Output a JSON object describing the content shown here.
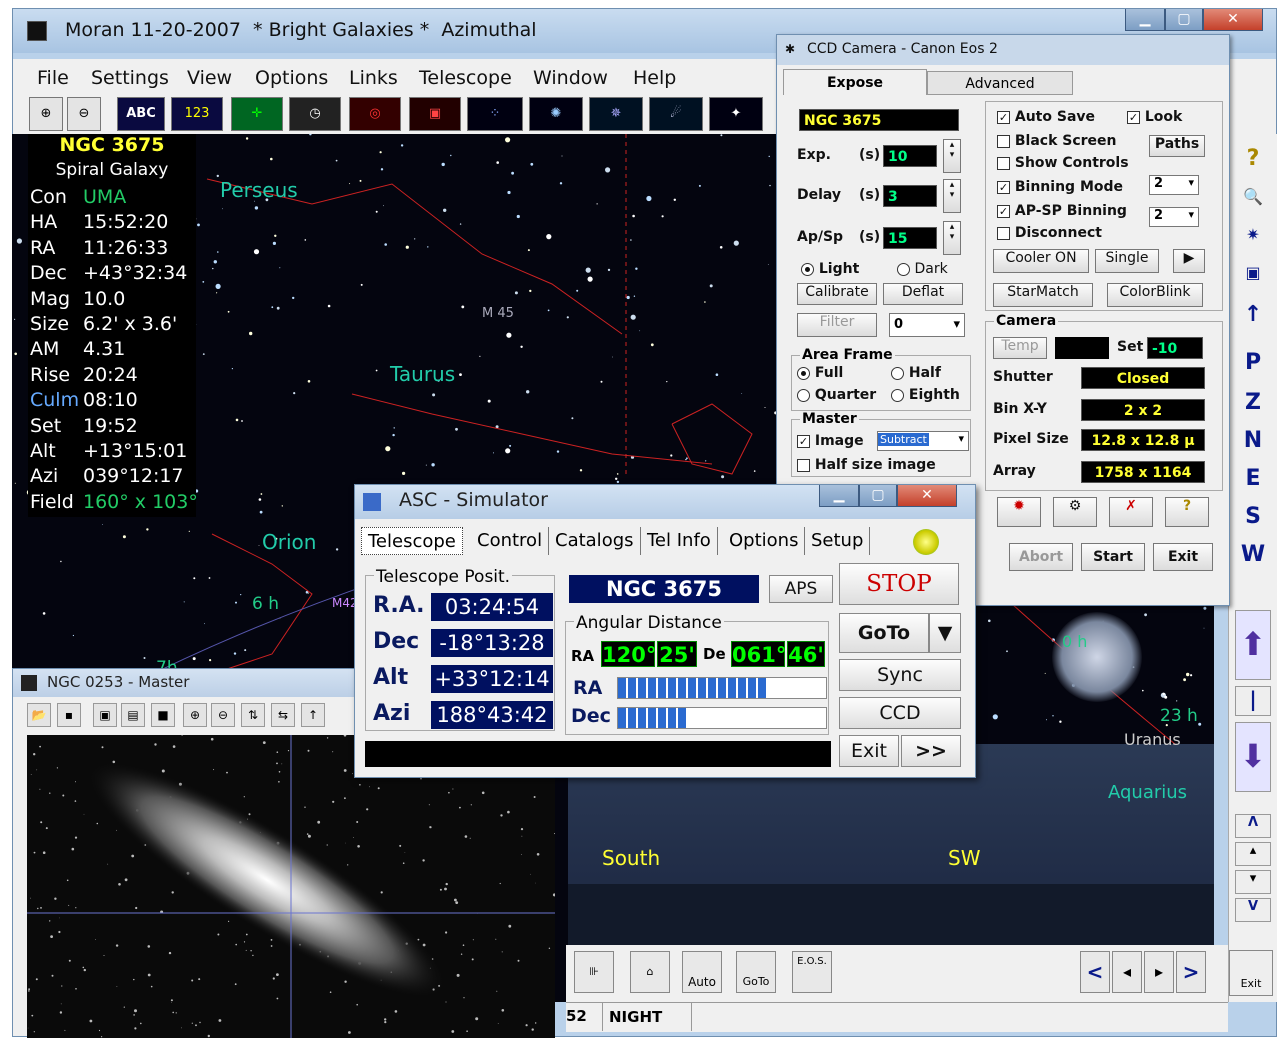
{
  "main": {
    "title": "Moran 11-20-2007  * Bright Galaxies *  Azimuthal",
    "menu": [
      "File",
      "Settings",
      "View",
      "Options",
      "Links",
      "Telescope",
      "Window",
      "Help"
    ],
    "toolbar": [
      "zoom-in-icon",
      "zoom-out-icon",
      "ABC",
      "1 2 3",
      "crosshair-icon",
      "clock-icon",
      "target-icon",
      "frame-icon",
      "stars-icon",
      "galaxy-icon",
      "nebula-icon",
      "comet-icon",
      "eclipse-icon"
    ],
    "abc_label": "ABC",
    "num_label": "123"
  },
  "object_info": {
    "name": "NGC 3675",
    "type": "Spiral Galaxy",
    "rows": [
      {
        "label": "Con",
        "value": "UMA",
        "accent": true
      },
      {
        "label": "HA",
        "value": "15:52:20"
      },
      {
        "label": "RA",
        "value": "11:26:33"
      },
      {
        "label": "Dec",
        "value": "+43°32:34"
      },
      {
        "label": "Mag",
        "value": "10.0"
      },
      {
        "label": "Size",
        "value": "6.2' x 3.6'"
      },
      {
        "label": "AM",
        "value": "4.31"
      },
      {
        "label": "Rise",
        "value": "20:24"
      },
      {
        "label": "Culm",
        "value": "08:10",
        "accent_label": true
      },
      {
        "label": "Set",
        "value": "19:52"
      },
      {
        "label": "Alt",
        "value": "+13°15:01"
      },
      {
        "label": "Azi",
        "value": "039°12:17"
      },
      {
        "label": "Field",
        "value": "160° x 103°",
        "accent": true
      }
    ]
  },
  "sky_labels": {
    "perseus": "Perseus",
    "taurus": "Taurus",
    "orion": "Orion",
    "m45": "M 45",
    "m42": "M42",
    "hour_6": "6 h",
    "hour_7": "7h",
    "hour_0": "0 h",
    "hour_23": "23 h",
    "uranus": "Uranus",
    "aquarius": "Aquarius",
    "south": "South",
    "sw": "SW"
  },
  "right_bar": {
    "letters": [
      "P",
      "Z",
      "N",
      "E",
      "S",
      "W"
    ],
    "arrow_up_label": "↑",
    "help_label": "?"
  },
  "status": {
    "left": "52",
    "mode": "NIGHT"
  },
  "bottom_buttons": [
    "Auto",
    "GoTo",
    "E.O.S."
  ],
  "nav_buttons": [
    "<",
    "◂",
    "▸",
    ">"
  ],
  "exit_label": "Exit",
  "ccd": {
    "title": "CCD Camera - Canon Eos 2",
    "tabs": [
      "Expose",
      "Advanced"
    ],
    "object": "NGC 3675",
    "exp_label": "Exp.",
    "exp_unit": "(s)",
    "exp_value": "10",
    "delay_label": "Delay",
    "delay_unit": "(s)",
    "delay_value": "3",
    "apsp_label": "Ap/Sp",
    "apsp_unit": "(s)",
    "apsp_value": "15",
    "light": "Light",
    "dark": "Dark",
    "calibrate": "Calibrate",
    "deflat": "Deflat",
    "filter": "Filter",
    "filter_value": "0",
    "area_frame": "Area Frame",
    "full": "Full",
    "half": "Half",
    "quarter": "Quarter",
    "eighth": "Eighth",
    "master": "Master",
    "image": "Image",
    "image_mode": "Subtract",
    "half_size": "Half size image",
    "auto_save": "Auto Save",
    "look": "Look",
    "black_screen": "Black Screen",
    "paths": "Paths",
    "show_controls": "Show Controls",
    "binning_mode": "Binning Mode",
    "binning_value": "2",
    "apsp_binning": "AP-SP Binning",
    "apsp_binning_value": "2",
    "disconnect": "Disconnect",
    "cooler": "Cooler ON",
    "single": "Single",
    "starmatch": "StarMatch",
    "colorblink": "ColorBlink",
    "camera": "Camera",
    "temp": "Temp",
    "set": "Set",
    "set_value": "-10",
    "shutter": "Shutter",
    "shutter_value": "Closed",
    "bin": "Bin  X-Y",
    "bin_value": "2 x 2",
    "pixel_size": "Pixel Size",
    "pixel_size_value": "12.8 x 12.8 µ",
    "array": "Array",
    "array_value": "1758 x 1164",
    "abort": "Abort",
    "start": "Start",
    "exit": "Exit"
  },
  "asc": {
    "title": "ASC - Simulator",
    "tabs": [
      "Telescope",
      "Control",
      "Catalogs",
      "Tel Info",
      "Options",
      "Setup"
    ],
    "position_title": "Telescope Posit.",
    "ra_label": "R.A.",
    "ra": "03:24:54",
    "dec_label": "Dec",
    "dec": "-18°13:28",
    "alt_label": "Alt",
    "alt": "+33°12:14",
    "azi_label": "Azi",
    "azi": "188°43:42",
    "target": "NGC 3675",
    "aps": "APS",
    "stop": "STOP",
    "angular_distance": "Angular Distance",
    "ad_ra_label": "RA",
    "ad_ra_deg": "120°",
    "ad_ra_min": "25'",
    "ad_de_label": "De",
    "ad_de_deg": "061°",
    "ad_de_min": "46'",
    "bar_ra_label": "RA",
    "bar_dec_label": "Dec",
    "bar_ra": 0.72,
    "bar_dec": 0.33,
    "goto": "GoTo",
    "sync": "Sync",
    "ccd": "CCD",
    "exit": "Exit",
    "more": ">>"
  },
  "ngc_window": {
    "title": "NGC 0253 - Master"
  }
}
